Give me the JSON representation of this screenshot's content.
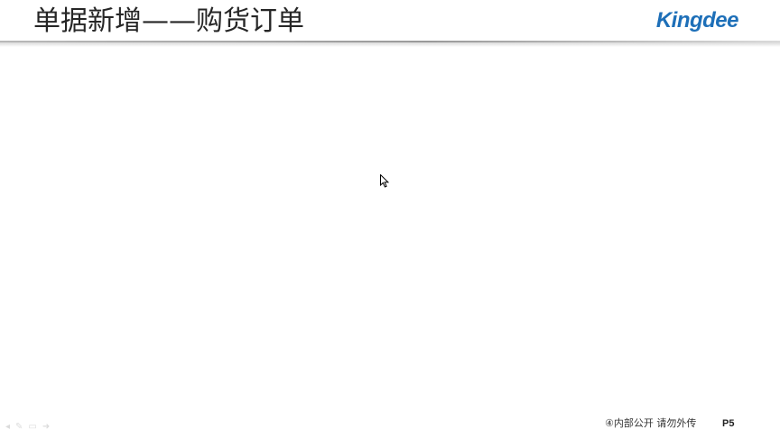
{
  "slide": {
    "title": "单据新增——购货订单",
    "logo_text": "Kingdee",
    "footer_note": "④内部公开 请勿外传",
    "page_number": "P5"
  },
  "colors": {
    "brand": "#1d6fb8",
    "title_text": "#262626"
  },
  "icons": {
    "nav_prev": "◂",
    "nav_pen": "✎",
    "nav_menu": "▭",
    "nav_next": "➜"
  }
}
